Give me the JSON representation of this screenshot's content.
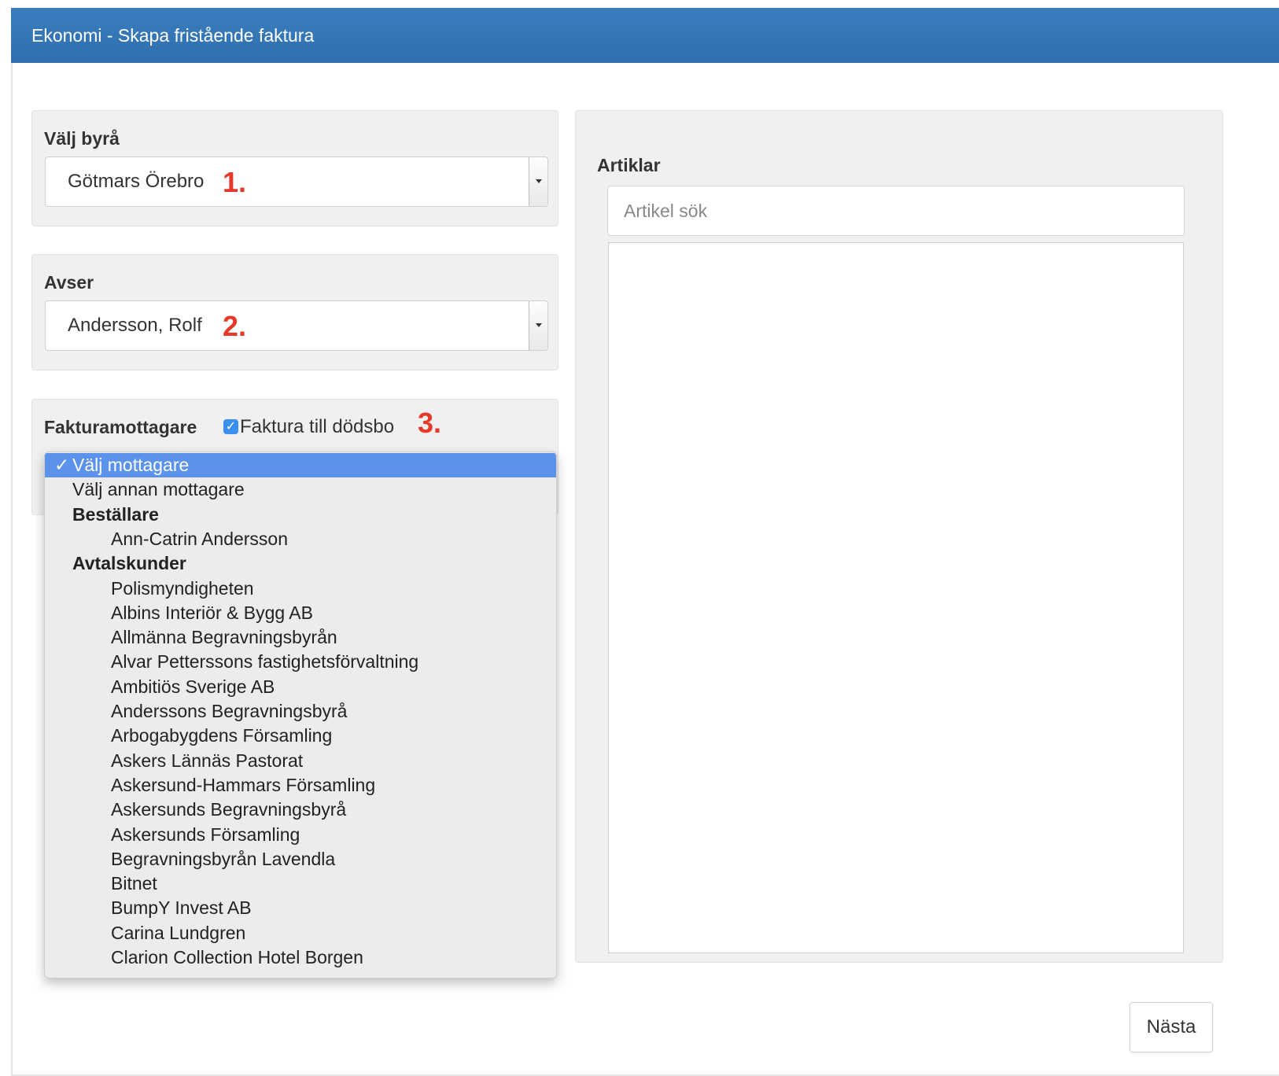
{
  "window": {
    "title": "Ekonomi - Skapa fristående faktura"
  },
  "byra": {
    "label": "Välj byrå",
    "selected": "Götmars Örebro",
    "annotation": "1."
  },
  "avser": {
    "label": "Avser",
    "selected": "Andersson, Rolf",
    "annotation": "2."
  },
  "mottagare": {
    "label": "Fakturamottagare",
    "checkbox_label": "Faktura till dödsbo",
    "checkbox_checked": true,
    "annotation": "3.",
    "dropdown": {
      "selected_check": "✓",
      "options": [
        {
          "label": "Välj mottagare",
          "type": "option",
          "selected": true
        },
        {
          "label": "Välj annan mottagare",
          "type": "option"
        },
        {
          "label": "Beställare",
          "type": "group"
        },
        {
          "label": "Ann-Catrin Andersson",
          "type": "child"
        },
        {
          "label": "Avtalskunder",
          "type": "group"
        },
        {
          "label": "Polismyndigheten",
          "type": "child"
        },
        {
          "label": "Albins Interiör & Bygg AB",
          "type": "child"
        },
        {
          "label": "Allmänna Begravningsbyrån",
          "type": "child"
        },
        {
          "label": "Alvar Petterssons fastighetsförvaltning",
          "type": "child"
        },
        {
          "label": "Ambitiös Sverige AB",
          "type": "child"
        },
        {
          "label": "Anderssons Begravningsbyrå",
          "type": "child"
        },
        {
          "label": "Arbogabygdens Församling",
          "type": "child"
        },
        {
          "label": "Askers Lännäs Pastorat",
          "type": "child"
        },
        {
          "label": "Askersund-Hammars Församling",
          "type": "child"
        },
        {
          "label": "Askersunds Begravningsbyrå",
          "type": "child"
        },
        {
          "label": "Askersunds Församling",
          "type": "child"
        },
        {
          "label": "Begravningsbyrån Lavendla",
          "type": "child"
        },
        {
          "label": "Bitnet",
          "type": "child"
        },
        {
          "label": "BumpY Invest AB",
          "type": "child"
        },
        {
          "label": "Carina Lundgren",
          "type": "child"
        },
        {
          "label": "Clarion Collection Hotel Borgen",
          "type": "child"
        }
      ]
    }
  },
  "artiklar": {
    "label": "Artiklar",
    "search_placeholder": "Artikel sök"
  },
  "footer": {
    "next_label": "Nästa"
  },
  "colors": {
    "titlebar": "#3379b8",
    "annotation": "#e5392a",
    "selected_option": "#5b93ec",
    "checkbox": "#3b8ff0"
  }
}
